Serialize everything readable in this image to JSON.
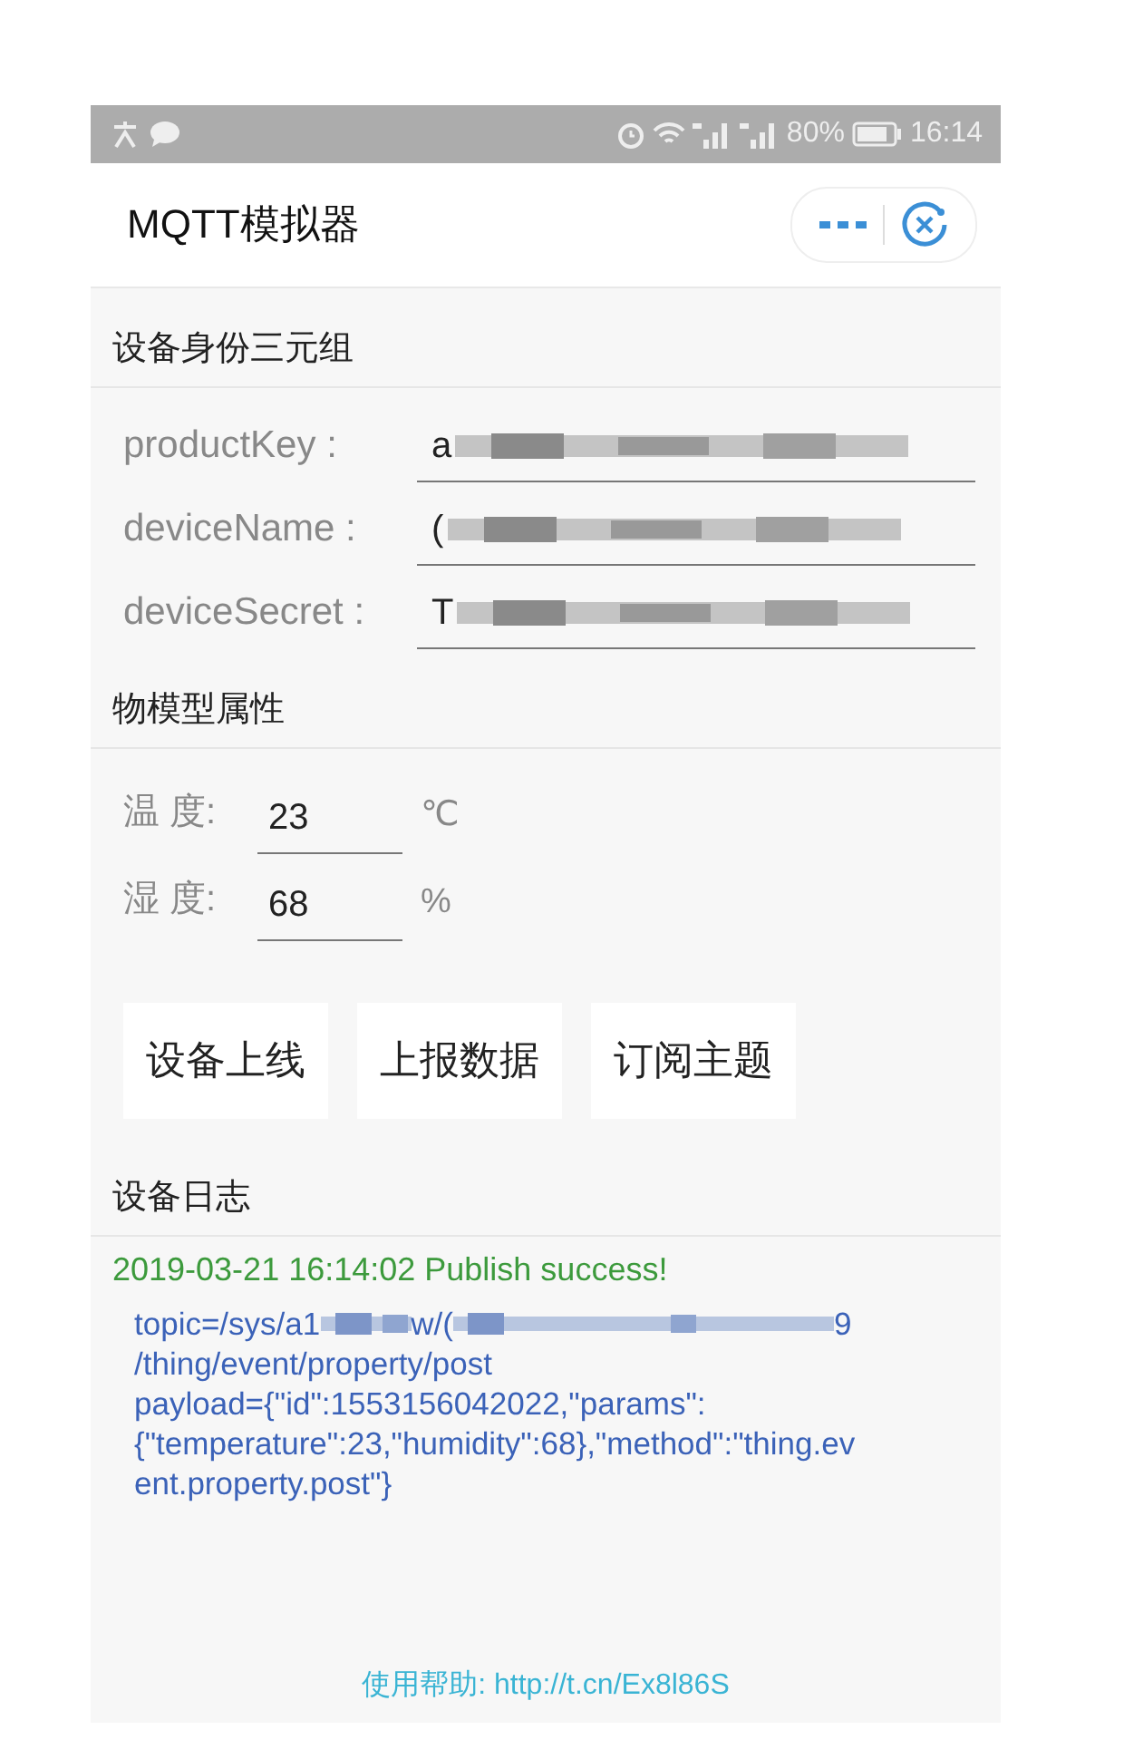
{
  "status_bar": {
    "battery": "80%",
    "time": "16:14"
  },
  "nav": {
    "title": "MQTT模拟器"
  },
  "identity": {
    "heading": "设备身份三元组",
    "fields": [
      {
        "label": "productKey :",
        "value": "a"
      },
      {
        "label": "deviceName :",
        "value": "("
      },
      {
        "label": "deviceSecret :",
        "value": "T"
      }
    ]
  },
  "properties": {
    "heading": "物模型属性",
    "fields": [
      {
        "label": "温 度:",
        "value": "23",
        "unit": "℃"
      },
      {
        "label": "湿 度:",
        "value": "68",
        "unit": "%"
      }
    ]
  },
  "buttons": [
    "设备上线",
    "上报数据",
    "订阅主题"
  ],
  "log": {
    "heading": "设备日志",
    "status": "2019-03-21 16:14:02 Publish success!",
    "topic_parts": [
      "topic=/sys/a1",
      "w/(",
      "9"
    ],
    "lines": [
      "/thing/event/property/post",
      "payload={\"id\":1553156042022,\"params\":",
      "{\"temperature\":23,\"humidity\":68},\"method\":\"thing.ev",
      "ent.property.post\"}"
    ]
  },
  "footer": {
    "help": "使用帮助: http://t.cn/Ex8l86S"
  }
}
